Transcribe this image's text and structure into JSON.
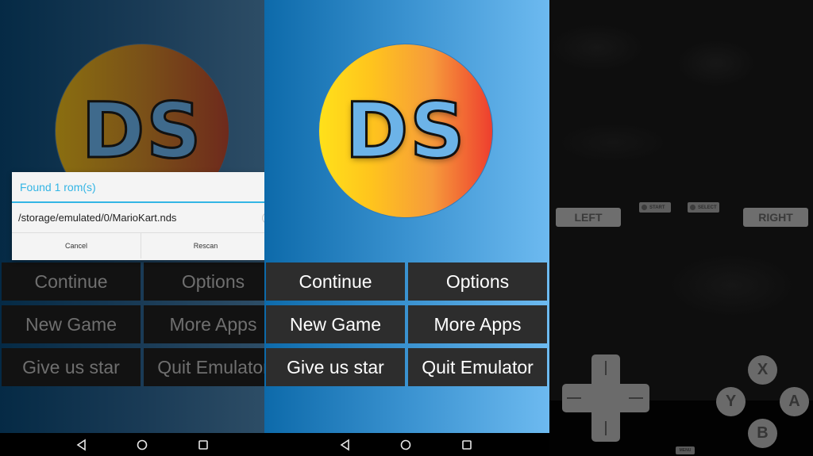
{
  "screens": {
    "dimmed_menu": {
      "logo_text": "DS",
      "menu": [
        "Continue",
        "Options",
        "New Game",
        "More Apps",
        "Give us star",
        "Quit Emulator"
      ],
      "dialog": {
        "title": "Found 1 rom(s)",
        "rom_item": "/storage/emulated/0/MarioKart.nds",
        "cancel_label": "Cancel",
        "rescan_label": "Rescan"
      }
    },
    "main_menu": {
      "logo_text": "DS",
      "menu": [
        "Continue",
        "Options",
        "New Game",
        "More Apps",
        "Give us star",
        "Quit Emulator"
      ]
    },
    "game": {
      "left_label": "LEFT",
      "right_label": "RIGHT",
      "start_label": "START",
      "select_label": "SELECT",
      "x_label": "X",
      "y_label": "Y",
      "a_label": "A",
      "b_label": "B",
      "menu_label": "MENU"
    }
  },
  "navbar": {
    "icons": [
      "back-icon",
      "home-icon",
      "recents-icon"
    ]
  },
  "colors": {
    "dialog_accent": "#33b5e5",
    "menu_button_bg": "#2d2d2d",
    "logo_blue": "#6cb3e8"
  }
}
